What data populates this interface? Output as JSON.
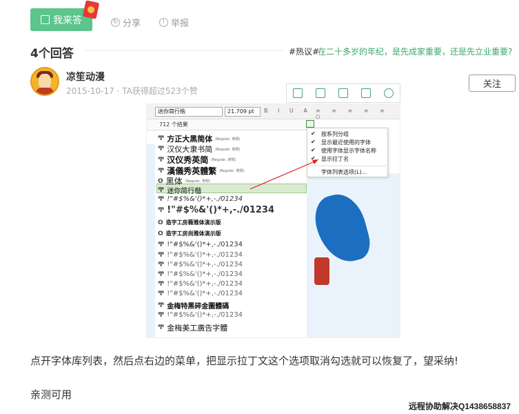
{
  "actions": {
    "answer_label": "我来答",
    "share_label": "分享",
    "report_label": "举报"
  },
  "answers": {
    "count_title": "4个回答",
    "hot_tag": "#热议#",
    "hot_topic": "在二十多岁的年纪，是先成家重要，还是先立业重要?"
  },
  "author": {
    "name": "凉笙动漫",
    "meta": "2015-10-17 · TA获得超过523个赞",
    "follow_label": "关注"
  },
  "image_toolbar": {
    "icons": [
      "bookmark-icon",
      "fullscreen-icon",
      "save-icon",
      "share-out-icon",
      "settings-icon"
    ]
  },
  "screenshot": {
    "font_select": "迷你简行楷",
    "size_select": "21.709 pt",
    "result_count": "712 个结果",
    "menu_items": [
      {
        "label": "按系列分组",
        "checked": true
      },
      {
        "label": "显示最近使用的字体",
        "checked": true
      },
      {
        "label": "使用字体显示字体名称",
        "checked": true
      },
      {
        "label": "显示拉丁名",
        "checked": true
      },
      {
        "label": "字体列表选项(L)...",
        "checked": false
      }
    ],
    "fonts": [
      {
        "name": "方正大黑简体",
        "style": "(Regular, 常规)"
      },
      {
        "name": "汉仪大隶书简",
        "style": "(Regular, 常规)"
      },
      {
        "name": "汉仪秀英简",
        "style": "(Regular, 常规)"
      },
      {
        "name": "漢儀秀英體繁",
        "style": "(Regular, 常规)"
      },
      {
        "name": "黑体",
        "style": "(Regular, 常规)"
      },
      {
        "name": "迷你简行楷",
        "style": ""
      },
      {
        "name": "",
        "sample": "!\"#$%&'()*+,-./01234"
      },
      {
        "name": "",
        "sample": "!\"#$%&'()*+,-./01234"
      },
      {
        "name": "造字工房薇雅体演示版",
        "style": ""
      },
      {
        "name": "造字工房尚雅体演示版",
        "style": ""
      },
      {
        "name": "",
        "sample": "!\"#$%&'()*+,-./01234"
      },
      {
        "name": "",
        "sample": "!\"#$%&'()*+,-./01234"
      },
      {
        "name": "",
        "sample": "!\"#$%&'()*+,-./01234"
      },
      {
        "name": "",
        "sample": "!\"#$%&'()*+,-./01234"
      },
      {
        "name": "",
        "sample": "!\"#$%&'()*+,-./01234"
      },
      {
        "name": "",
        "sample": "!\"#$%&'()*+,-./01234"
      },
      {
        "name": "金梅特黑碎金圖體碼",
        "style": ""
      },
      {
        "name": "",
        "sample": "!\"#$%&'()*+,-./01234"
      },
      {
        "name": "金梅美工廣告字體",
        "style": ""
      }
    ]
  },
  "content": {
    "paragraph1": "点开字体库列表，然后点右边的菜单，把显示拉丁文这个选项取消勾选就可以恢复了，望采纳!",
    "paragraph2": "亲测可用"
  },
  "watermark": "远程协助解决Q1438658837",
  "colors": {
    "accent_green": "#5bc58b",
    "topic_green": "#3aa76d"
  }
}
